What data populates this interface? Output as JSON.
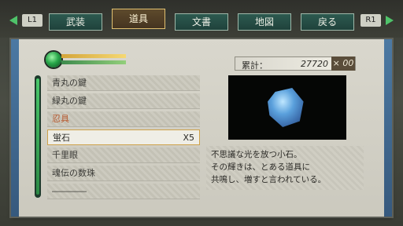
{
  "header": {
    "shoulder_left": "L1",
    "shoulder_right": "R1",
    "tabs": [
      {
        "label": "武装"
      },
      {
        "label": "道具"
      },
      {
        "label": "文書"
      },
      {
        "label": "地図"
      },
      {
        "label": "戻る"
      }
    ],
    "active_tab": "道具"
  },
  "items": [
    {
      "name": "青丸の鍵",
      "qty": ""
    },
    {
      "name": "緑丸の鍵",
      "qty": ""
    },
    {
      "name": "忍具",
      "qty": ""
    },
    {
      "name": "蛍石",
      "qty": "X5"
    },
    {
      "name": "千里眼",
      "qty": ""
    },
    {
      "name": "魂伝の数珠",
      "qty": ""
    },
    {
      "name": "――――",
      "qty": ""
    }
  ],
  "selected_item": "蛍石",
  "money": {
    "label": "累計：",
    "value": "27720",
    "multiplier": "× 00"
  },
  "description": {
    "line1": "不思議な光を放つ小石。",
    "line2": "その輝きは、とある道具に",
    "line3": "共鳴し、増すと言われている。"
  },
  "colors": {
    "accent_green": "#4fc36a",
    "active_tab_border": "#e0c070",
    "special_item_text": "#b7572c"
  },
  "icons": {
    "orb": "green-orb-icon",
    "item_image": "fluorite-stone-image"
  }
}
